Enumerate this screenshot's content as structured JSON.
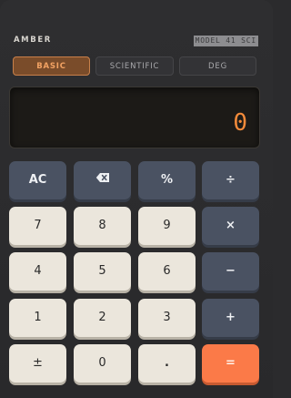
{
  "brand": "AMBER",
  "model": "MODEL 41 SCI",
  "modes": {
    "basic": "BASIC",
    "scientific": "SCIENTIFIC",
    "angle": "DEG",
    "active": "BASIC"
  },
  "display": {
    "value": "0"
  },
  "keys": {
    "clear": "AC",
    "backspace_icon": "backspace-icon",
    "percent": "%",
    "divide": "÷",
    "seven": "7",
    "eight": "8",
    "nine": "9",
    "multiply": "×",
    "four": "4",
    "five": "5",
    "six": "6",
    "minus": "−",
    "one": "1",
    "two": "2",
    "three": "3",
    "plus": "+",
    "sign": "±",
    "zero": "0",
    "decimal": ".",
    "equals": "="
  },
  "colors": {
    "accent": "#fb7a48",
    "display_text": "#f28a3a",
    "operator_key": "#4a5262",
    "number_key": "#ebe6dc"
  }
}
